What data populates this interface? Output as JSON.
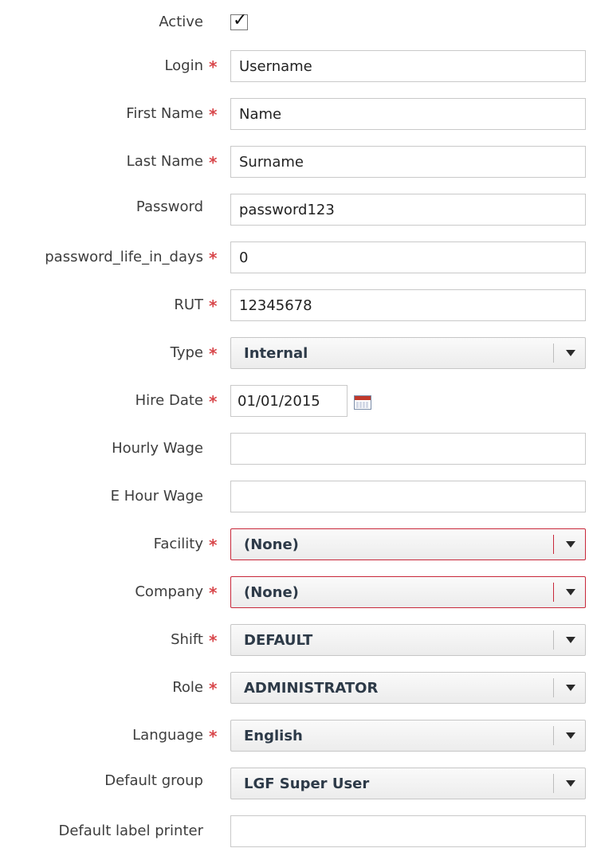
{
  "form": {
    "active": {
      "label": "Active",
      "checked": true
    },
    "login": {
      "label": "Login",
      "value": "Username",
      "required": true
    },
    "first_name": {
      "label": "First Name",
      "value": "Name",
      "required": true
    },
    "last_name": {
      "label": "Last Name",
      "value": "Surname",
      "required": true
    },
    "password": {
      "label": "Password",
      "value": "password123",
      "required": false
    },
    "password_life": {
      "label": "password_life_in_days",
      "value": "0",
      "required": true
    },
    "rut": {
      "label": "RUT",
      "value": "12345678",
      "required": true
    },
    "type": {
      "label": "Type",
      "value": "Internal",
      "required": true
    },
    "hire_date": {
      "label": "Hire Date",
      "value": "01/01/2015",
      "required": true
    },
    "hourly_wage": {
      "label": "Hourly Wage",
      "value": "",
      "required": false
    },
    "e_hour_wage": {
      "label": "E Hour Wage",
      "value": "",
      "required": false
    },
    "facility": {
      "label": "Facility",
      "value": "(None)",
      "required": true,
      "invalid": true
    },
    "company": {
      "label": "Company",
      "value": "(None)",
      "required": true,
      "invalid": true
    },
    "shift": {
      "label": "Shift",
      "value": "DEFAULT",
      "required": true
    },
    "role": {
      "label": "Role",
      "value": "ADMINISTRATOR",
      "required": true
    },
    "language": {
      "label": "Language",
      "value": "English",
      "required": true
    },
    "default_group": {
      "label": "Default group",
      "value": "LGF Super User",
      "required": false
    },
    "default_label_printer": {
      "label": "Default label printer",
      "value": "",
      "required": false
    }
  },
  "required_marker": "*",
  "colors": {
    "required": "#d8474b",
    "invalid_border": "#c8283a",
    "label": "#3d3d3d"
  },
  "icons": {
    "checkbox_mark": "check-icon",
    "dropdown": "chevron-down-icon",
    "calendar": "calendar-icon"
  }
}
